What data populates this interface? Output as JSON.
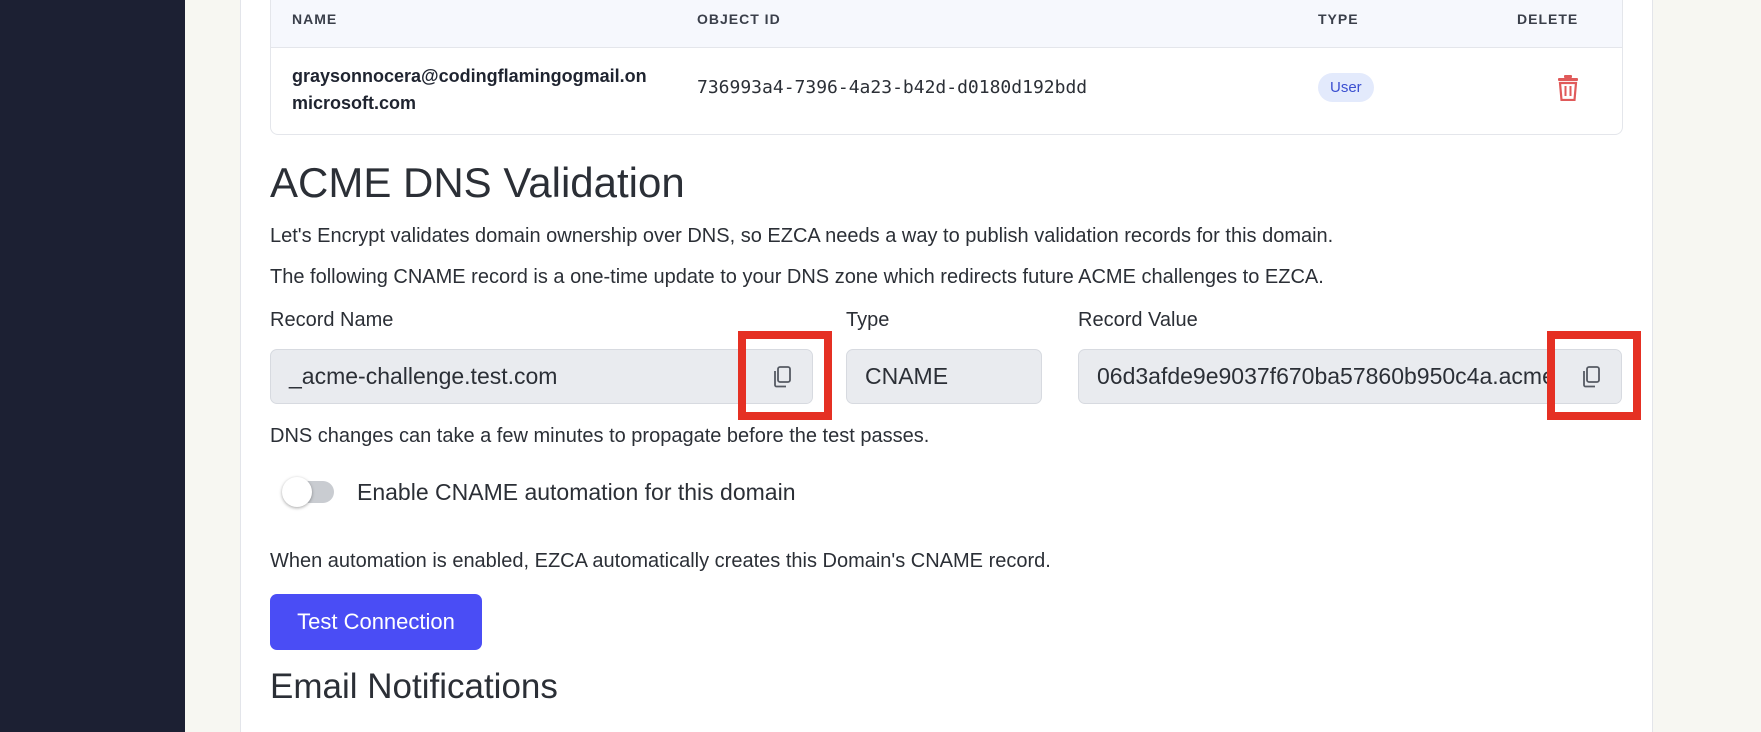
{
  "table": {
    "headers": {
      "name": "NAME",
      "object_id": "OBJECT ID",
      "type": "TYPE",
      "delete": "DELETE"
    },
    "rows": [
      {
        "name": "graysonnocera@codingflamingogmail.onmicrosoft.com",
        "object_id": "736993a4-7396-4a23-b42d-d0180d192bdd",
        "type": "User"
      }
    ]
  },
  "acme": {
    "title": "ACME DNS Validation",
    "description_1": "Let's Encrypt validates domain ownership over DNS, so EZCA needs a way to publish validation records for this domain.",
    "description_2": "The following CNAME record is a one-time update to your DNS zone which redirects future ACME challenges to EZCA.",
    "record_name_label": "Record Name",
    "record_name_value": "_acme-challenge.test.com",
    "type_label": "Type",
    "type_value": "CNAME",
    "record_value_label": "Record Value",
    "record_value_value": "06d3afde9e9037f670ba57860b950c4a.acme",
    "propagation_note": "DNS changes can take a few minutes to propagate before the test passes.",
    "automation_toggle_label": "Enable CNAME automation for this domain",
    "automation_toggle_on": false,
    "automation_note": "When automation is enabled, EZCA automatically creates this Domain's CNAME record.",
    "test_button_label": "Test Connection"
  },
  "email_notifications": {
    "title": "Email Notifications"
  },
  "colors": {
    "sidebar": "#1c2033",
    "primary_button": "#4a4df5",
    "delete_icon": "#e05a5a",
    "highlight": "#e53023",
    "badge_bg": "#e3eafc",
    "badge_text": "#3b4fd0"
  }
}
